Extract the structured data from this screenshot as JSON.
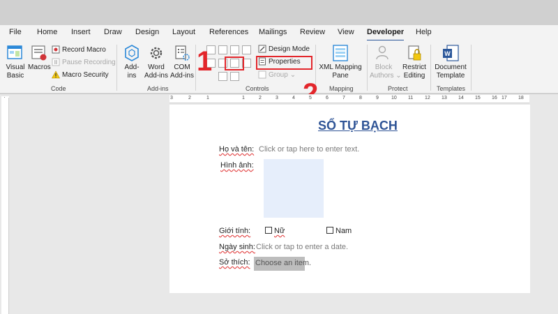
{
  "menu": {
    "tabs": [
      "File",
      "Home",
      "Insert",
      "Draw",
      "Design",
      "Layout",
      "References",
      "Mailings",
      "Review",
      "View",
      "Developer",
      "Help"
    ],
    "active": "Developer"
  },
  "ribbon": {
    "code": {
      "label": "Code",
      "visual_basic_1": "Visual",
      "visual_basic_2": "Basic",
      "macros": "Macros",
      "record_macro": "Record Macro",
      "pause_recording": "Pause Recording",
      "macro_security": "Macro Security"
    },
    "addins": {
      "label": "Add-ins",
      "addins_1": "Add-",
      "addins_2": "ins",
      "word_addins_1": "Word",
      "word_addins_2": "Add-ins",
      "com_addins_1": "COM",
      "com_addins_2": "Add-ins"
    },
    "controls": {
      "label": "Controls",
      "design_mode": "Design Mode",
      "properties": "Properties",
      "group": "Group"
    },
    "mapping": {
      "label": "Mapping",
      "xml_1": "XML Mapping",
      "xml_2": "Pane"
    },
    "protect": {
      "label": "Protect",
      "block_1": "Block",
      "block_2": "Authors",
      "restrict_1": "Restrict",
      "restrict_2": "Editing"
    },
    "templates": {
      "label": "Templates",
      "doc_1": "Document",
      "doc_2": "Template"
    }
  },
  "annotations": {
    "step1": "1",
    "step2": "2"
  },
  "ruler": {
    "corner": "L",
    "left_ticks": [
      "3",
      "2",
      "1"
    ],
    "right_ticks": [
      "1",
      "2",
      "3",
      "4",
      "5",
      "6",
      "7",
      "8",
      "9",
      "10",
      "11",
      "12",
      "13",
      "14",
      "15",
      "16",
      "17",
      "18"
    ]
  },
  "document": {
    "title": "SỔ TỰ BẠCH",
    "name_label": "Họ và tên:",
    "name_placeholder": "Click or tap here to enter text.",
    "photo_label": "Hình ảnh:",
    "gender_label": "Giới tính:",
    "gender_female": "Nữ",
    "gender_male": "Nam",
    "dob_label": "Ngày sinh:",
    "dob_placeholder": "Click or tap to enter a date.",
    "hobby_label": "Sở thích:",
    "hobby_placeholder": "Choose an item."
  },
  "colors": {
    "accent": "#2b579a",
    "highlight": "#e3262b",
    "title": "#2f5496"
  }
}
